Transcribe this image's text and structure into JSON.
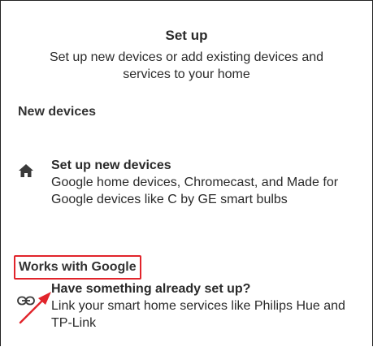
{
  "header": {
    "title": "Set up",
    "subtitle": "Set up new devices or add existing devices and services to your home"
  },
  "sections": {
    "new_devices": {
      "title": "New devices",
      "item": {
        "icon": "home-icon",
        "title": "Set up new devices",
        "description": "Google home devices, Chromecast, and Made for Google devices like C by GE smart bulbs"
      }
    },
    "works_with_google": {
      "title": "Works with Google",
      "highlight_color": "#e1242b",
      "item": {
        "icon": "link-icon",
        "title": "Have something already set up?",
        "description": "Link your smart home services like Philips Hue and TP-Link"
      }
    }
  },
  "annotation": {
    "arrow_color": "#e1242b"
  }
}
